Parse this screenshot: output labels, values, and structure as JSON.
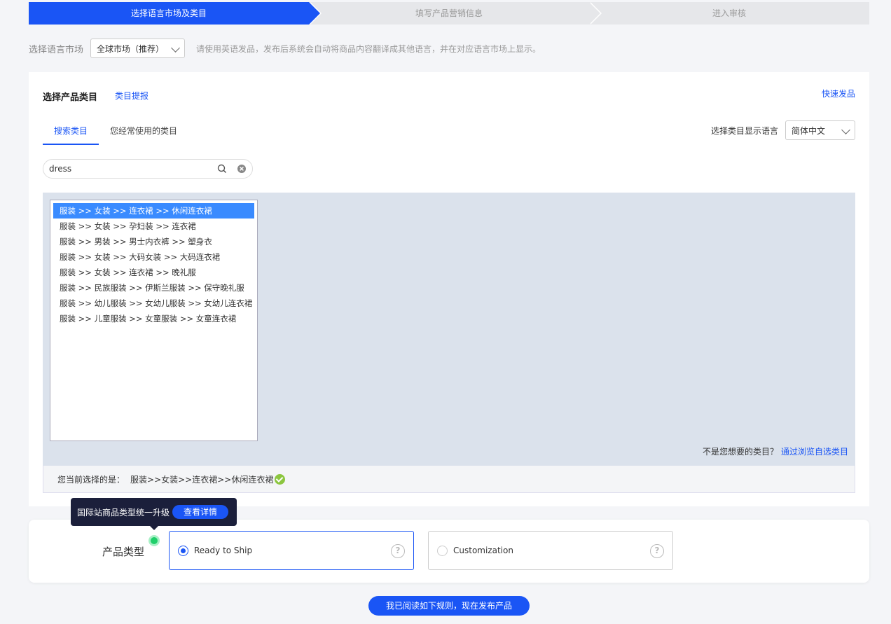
{
  "steps": [
    {
      "label": "选择语言市场及类目",
      "active": true
    },
    {
      "label": "填写产品营销信息",
      "active": false
    },
    {
      "label": "进入审核",
      "active": false
    }
  ],
  "language_market": {
    "label": "选择语言市场",
    "selected": "全球市场（推荐）",
    "tip": "请使用英语发品，发布后系统会自动将商品内容翻译成其他语言，并在对应语言市场上显示。"
  },
  "category": {
    "title": "选择产品类目",
    "suggest_link": "类目提报",
    "quick_publish": "快速发品",
    "tabs": [
      "搜索类目",
      "您经常使用的类目"
    ],
    "display_lang_label": "选择类目显示语言",
    "display_lang_value": "简体中文",
    "search_value": "dress",
    "results": [
      "服装 >> 女装 >> 连衣裙 >> 休闲连衣裙",
      "服装 >> 女装 >> 孕妇装 >> 连衣裙",
      "服装 >> 男装 >> 男士内衣裤 >> 塑身衣",
      "服装 >> 女装 >> 大码女装 >> 大码连衣裙",
      "服装 >> 女装 >> 连衣裙 >> 晚礼服",
      "服装 >> 民族服装 >> 伊斯兰服装 >> 保守晚礼服",
      "服装 >> 幼儿服装 >> 女幼儿服装 >> 女幼儿连衣裙",
      "服装 >> 儿童服装 >> 女童服装 >> 女童连衣裙"
    ],
    "not_wanted_text": "不是您想要的类目？",
    "browse_link": "通过浏览自选类目",
    "current_label": "您当前选择的是：",
    "current_value": "服装>>女装>>连衣裙>>休闲连衣裙"
  },
  "tooltip": {
    "text": "国际站商品类型统一升级",
    "button": "查看详情"
  },
  "product_type": {
    "label": "产品类型",
    "options": [
      {
        "label": "Ready to Ship",
        "selected": true
      },
      {
        "label": "Customization",
        "selected": false
      }
    ]
  },
  "publish_button": "我已阅读如下规则，现在发布产品",
  "colors": {
    "accent": "#1a55f5",
    "selected_row": "#3a8bff",
    "tooltip_bg": "#1b1f3b",
    "success": "#8cc63f"
  }
}
